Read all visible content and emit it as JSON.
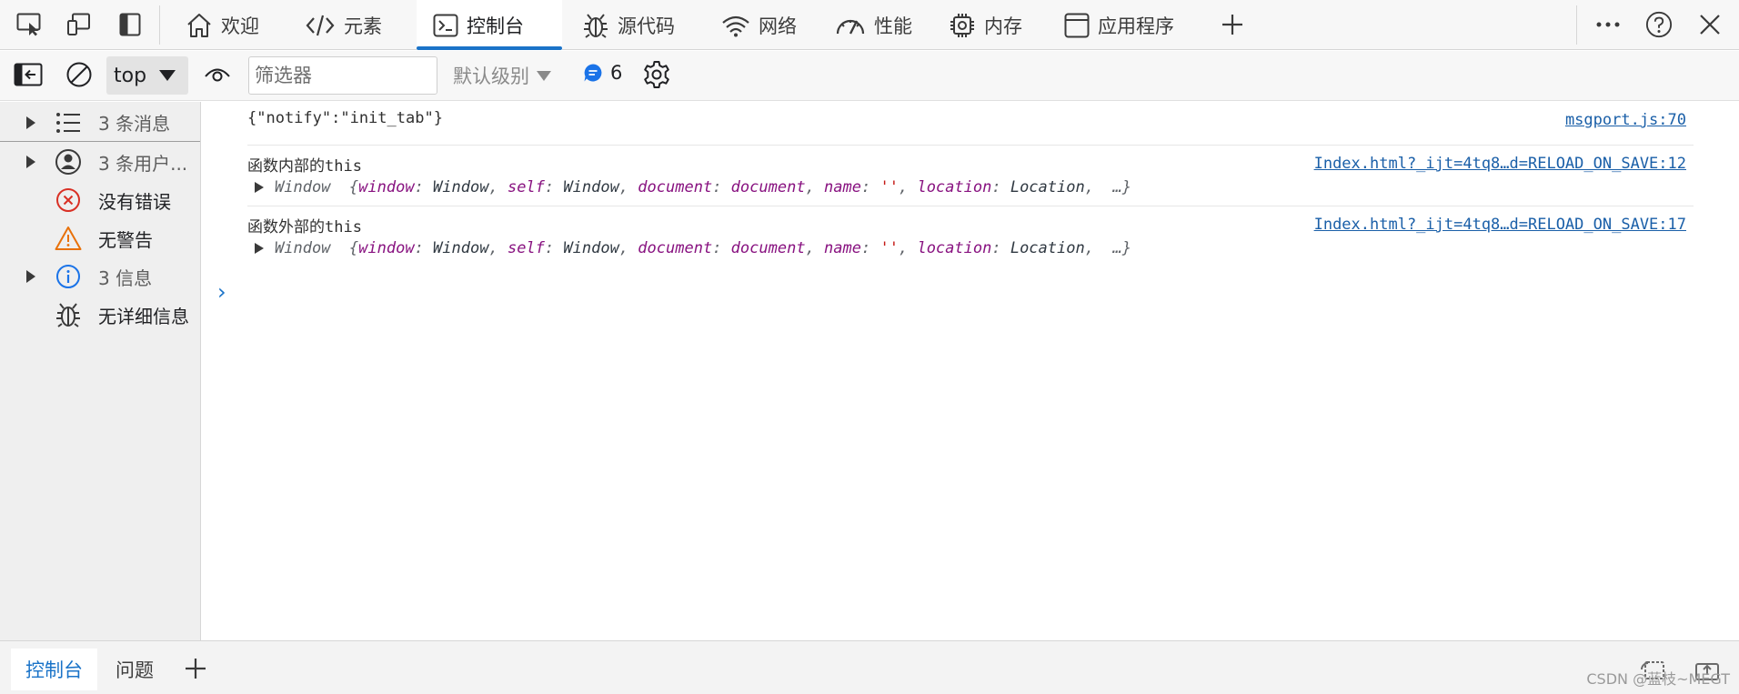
{
  "top_tabs": [
    {
      "label": "欢迎",
      "icon": "home-icon"
    },
    {
      "label": "元素",
      "icon": "code-icon"
    },
    {
      "label": "控制台",
      "icon": "console-icon",
      "active": true
    },
    {
      "label": "源代码",
      "icon": "bug-icon"
    },
    {
      "label": "网络",
      "icon": "wifi-icon"
    },
    {
      "label": "性能",
      "icon": "gauge-icon"
    },
    {
      "label": "内存",
      "icon": "chip-icon"
    },
    {
      "label": "应用程序",
      "icon": "window-icon"
    }
  ],
  "toolbar": {
    "context": "top",
    "filter_placeholder": "筛选器",
    "levels": "默认级别",
    "issues_count": "6"
  },
  "sidebar": {
    "items": [
      {
        "label": "3 条消息",
        "icon": "list-icon",
        "expandable": true
      },
      {
        "label": "3 条用户...",
        "icon": "user-icon",
        "expandable": true
      },
      {
        "label": "没有错误",
        "icon": "error-icon",
        "expandable": false
      },
      {
        "label": "无警告",
        "icon": "warning-icon",
        "expandable": false
      },
      {
        "label": "3 信息",
        "icon": "info-icon",
        "expandable": true
      },
      {
        "label": "无详细信息",
        "icon": "bug-icon",
        "expandable": false
      }
    ]
  },
  "console": {
    "messages": [
      {
        "text": "{\"notify\":\"init_tab\"}",
        "source": "msgport.js:70"
      },
      {
        "text": "函数内部的this",
        "source": "Index.html?_ijt=4tq8…d=RELOAD_ON_SAVE:12",
        "object": {
          "name": "Window",
          "props": [
            {
              "k": "window",
              "v": "Window"
            },
            {
              "k": "self",
              "v": "Window"
            },
            {
              "k": "document",
              "v": "document"
            },
            {
              "k": "name",
              "v": "''"
            },
            {
              "k": "location",
              "v": "Location"
            }
          ],
          "ellipsis": "…"
        }
      },
      {
        "text": "函数外部的this",
        "source": "Index.html?_ijt=4tq8…d=RELOAD_ON_SAVE:17",
        "object": {
          "name": "Window",
          "props": [
            {
              "k": "window",
              "v": "Window"
            },
            {
              "k": "self",
              "v": "Window"
            },
            {
              "k": "document",
              "v": "document"
            },
            {
              "k": "name",
              "v": "''"
            },
            {
              "k": "location",
              "v": "Location"
            }
          ],
          "ellipsis": "…"
        }
      }
    ]
  },
  "drawer": {
    "tabs": [
      {
        "label": "控制台",
        "active": true
      },
      {
        "label": "问题",
        "active": false
      }
    ]
  },
  "watermark": "CSDN @蓝枝~MEGT",
  "colors": {
    "accent": "#1a73c8",
    "link": "#1a5fa8",
    "prop_key": "#881280",
    "error": "#d93025",
    "warning": "#e8710a"
  }
}
